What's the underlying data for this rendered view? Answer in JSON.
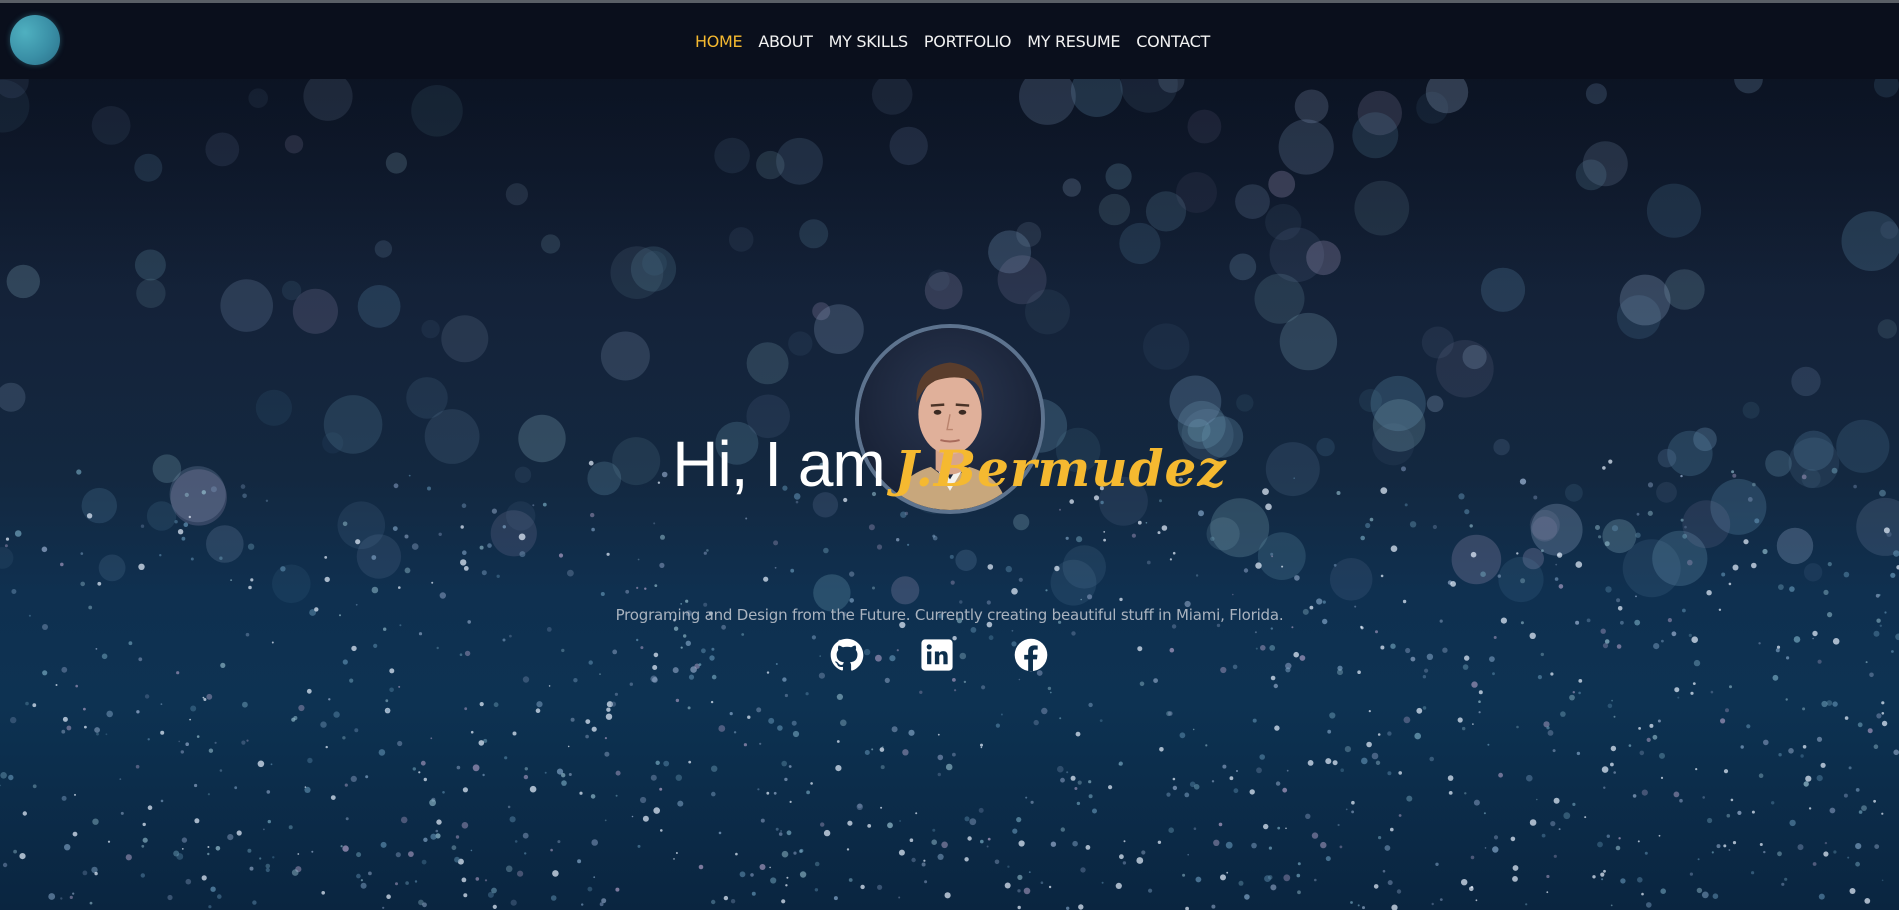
{
  "nav": {
    "items": [
      {
        "label": "HOME",
        "active": true
      },
      {
        "label": "ABOUT",
        "active": false
      },
      {
        "label": "MY SKILLS",
        "active": false
      },
      {
        "label": "PORTFOLIO",
        "active": false
      },
      {
        "label": "MY RESUME",
        "active": false
      },
      {
        "label": "CONTACT",
        "active": false
      }
    ]
  },
  "hero": {
    "greeting": "Hi, I am",
    "name": "J.Bermudez",
    "tagline": "Programing and Design from the Future. Currently creating beautiful stuff in Miami, Florida."
  },
  "social": [
    {
      "icon": "github-icon"
    },
    {
      "icon": "linkedin-icon"
    },
    {
      "icon": "facebook-icon"
    }
  ],
  "colors": {
    "accent": "#f5b930",
    "nav_bg": "#0a0f1c",
    "logo": "#3a8fa6"
  }
}
